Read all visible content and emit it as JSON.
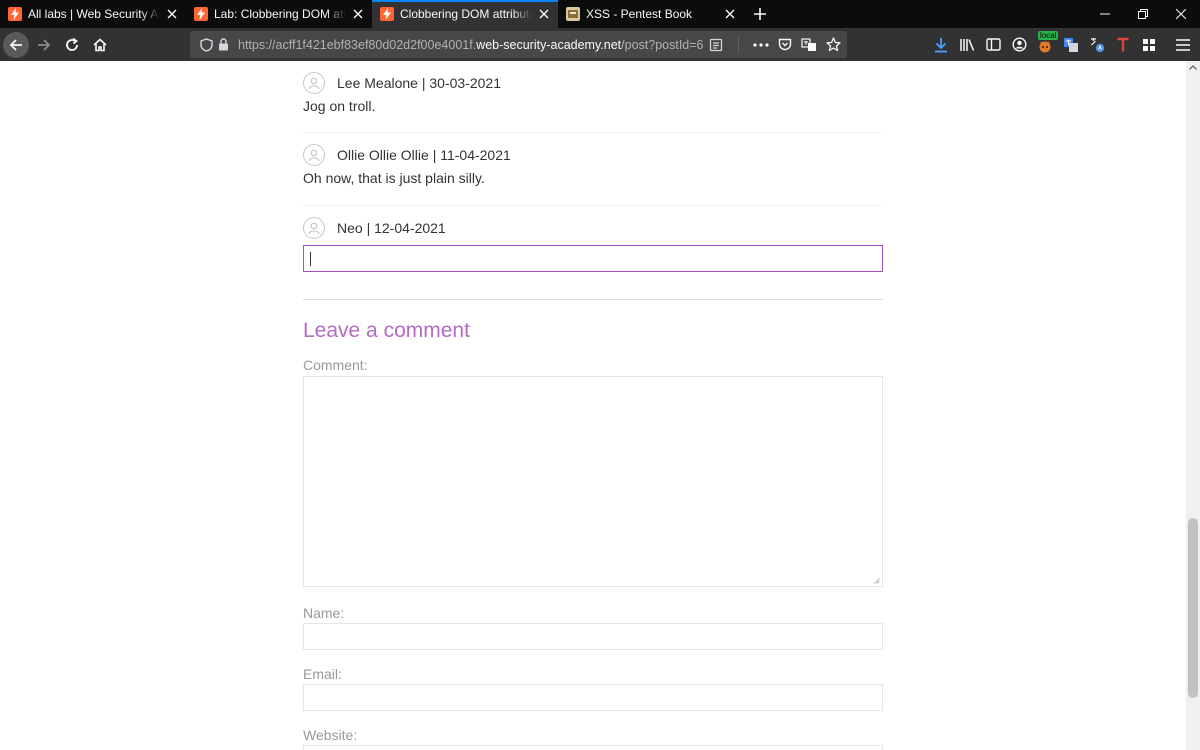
{
  "tabs": [
    {
      "title": "All labs | Web Security Academy",
      "icon": "portswigger-icon",
      "active": false
    },
    {
      "title": "Lab: Clobbering DOM attributes to bypass HTML filters",
      "icon": "portswigger-icon",
      "active": false
    },
    {
      "title": "Clobbering DOM attributes to bypass HTML filters",
      "icon": "portswigger-icon",
      "active": true
    },
    {
      "title": "XSS - Pentest Book",
      "icon": "pentest-book-icon",
      "active": false
    }
  ],
  "url": {
    "prefix": "https://acff1f421ebf83ef80d02d2f00e4001f.",
    "host": "web-security-academy.net",
    "path": "/post?postId=6"
  },
  "toolbar": {
    "local_badge": "local"
  },
  "comments": [
    {
      "author": "Lee Mealone | 30-03-2021",
      "body": "Jog on troll."
    },
    {
      "author": "Ollie Ollie Ollie | 11-04-2021",
      "body": "Oh now, that is just plain silly."
    },
    {
      "author": "Neo | 12-04-2021",
      "body": ""
    }
  ],
  "form": {
    "title": "Leave a comment",
    "comment_label": "Comment:",
    "name_label": "Name:",
    "email_label": "Email:",
    "website_label": "Website:"
  },
  "colors": {
    "accent": "#b36bc4",
    "focus_border": "#a64dbf",
    "tab_active_indicator": "#0a84ff"
  }
}
